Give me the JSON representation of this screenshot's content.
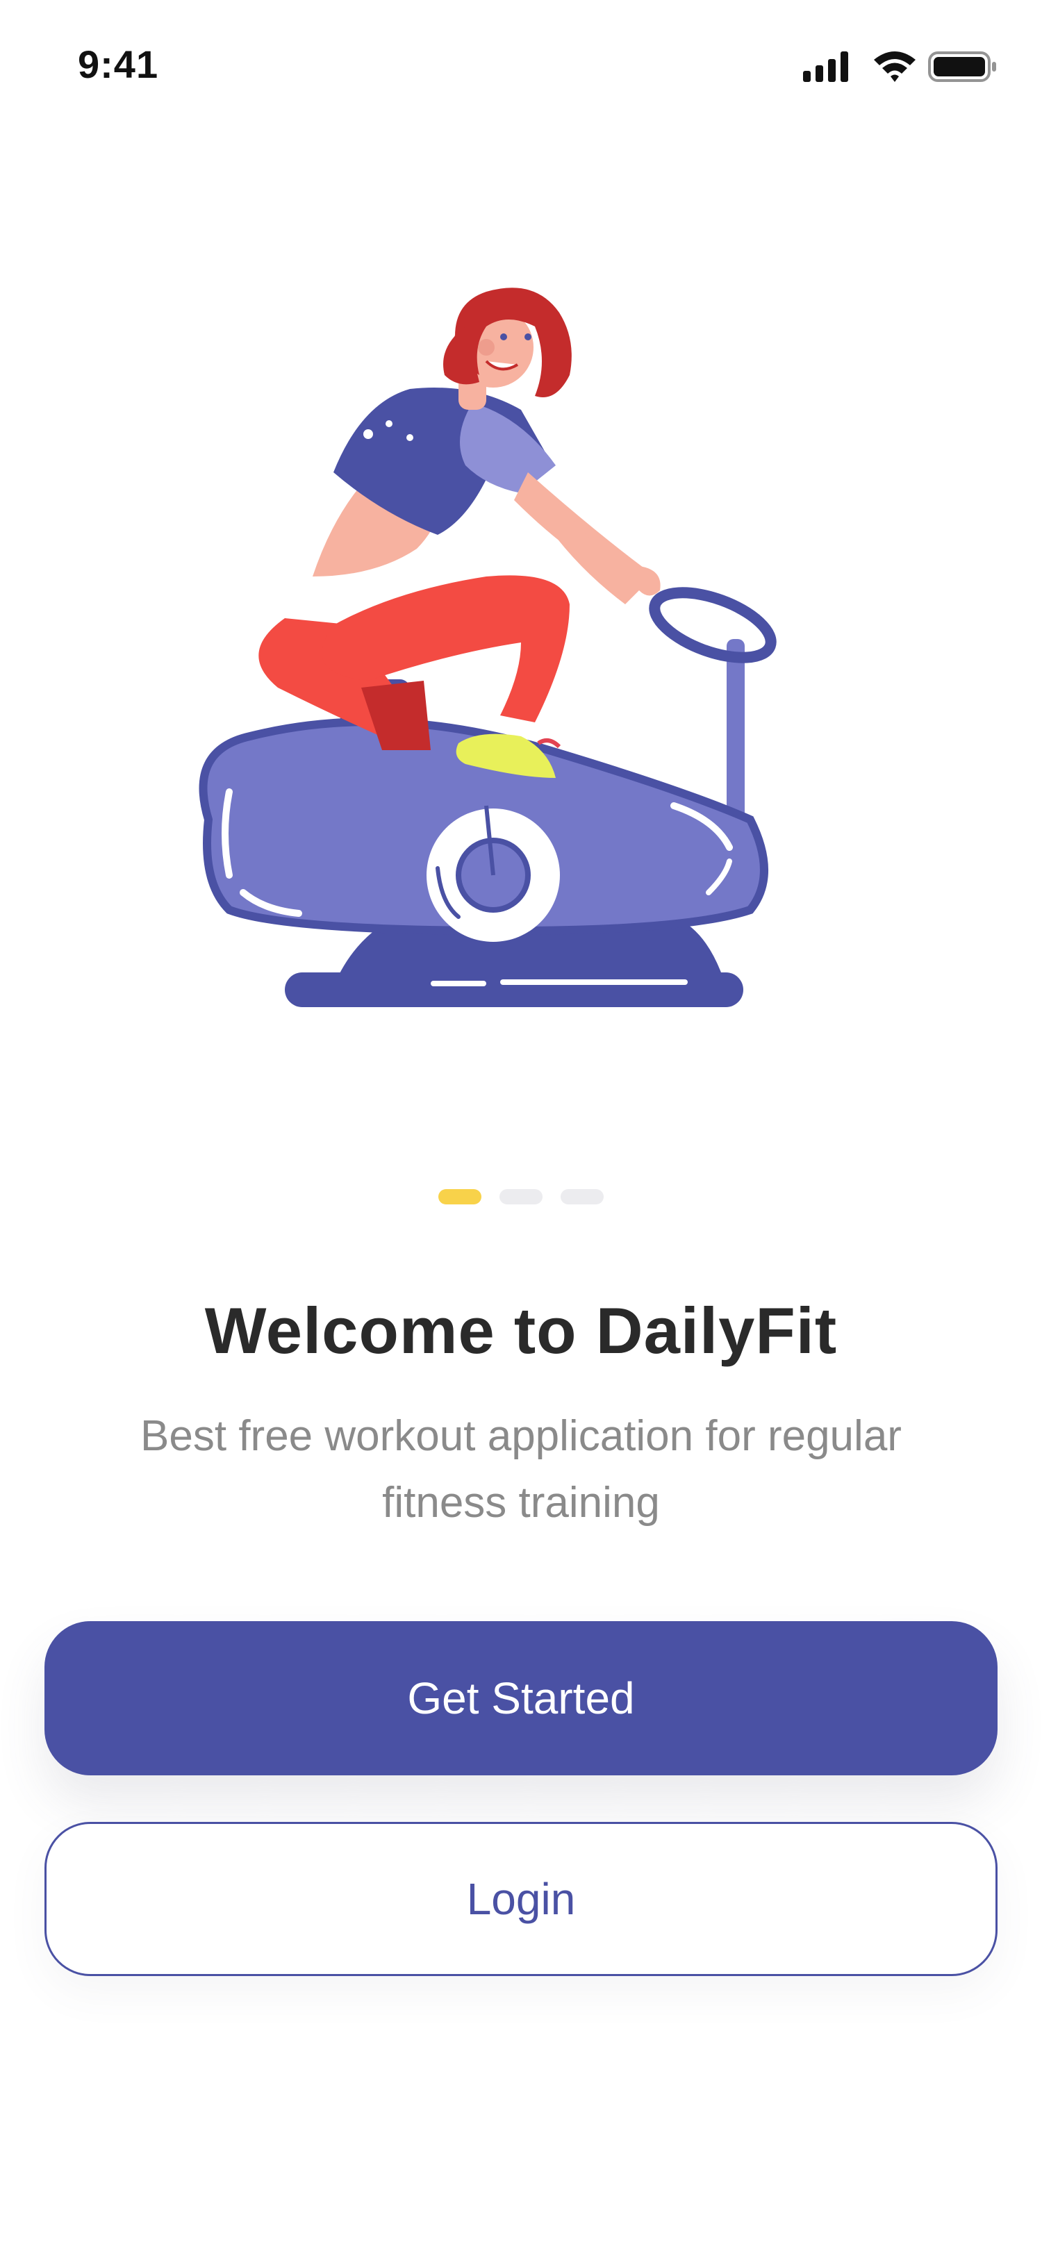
{
  "status_bar": {
    "time": "9:41",
    "icons": [
      "signal-icon",
      "wifi-icon",
      "battery-icon"
    ]
  },
  "hero": {
    "illustration": "woman-on-exercise-bike-illustration"
  },
  "pager": {
    "count": 3,
    "active_index": 0,
    "active_color": "#f8d24a",
    "inactive_color": "#ececef"
  },
  "welcome": {
    "title": "Welcome to DailyFit",
    "subtitle_line1": "Best free workout application for regular",
    "subtitle_line2": "fitness training"
  },
  "actions": {
    "get_started_label": "Get Started",
    "login_label": "Login"
  },
  "colors": {
    "primary": "#4a51a4",
    "accent": "#f8d24a",
    "title_text": "#2a2a2a",
    "subtitle_text": "#8a8a8a"
  }
}
